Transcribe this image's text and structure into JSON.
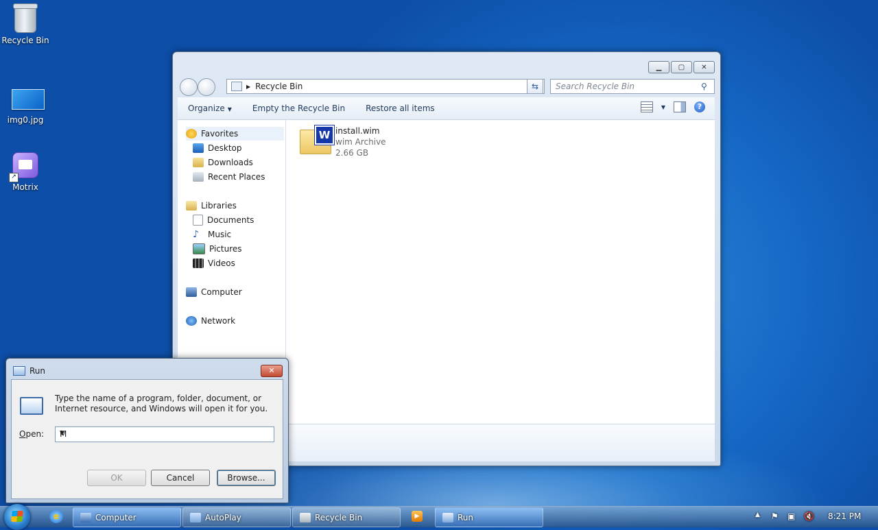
{
  "desktop": {
    "icons": [
      {
        "label": "Recycle Bin",
        "icon": "recycle-bin-icon"
      },
      {
        "label": "img0.jpg",
        "icon": "image-file-icon"
      },
      {
        "label": "Motrix",
        "icon": "motrix-app-icon"
      }
    ]
  },
  "explorer": {
    "address": "Recycle Bin",
    "search_placeholder": "Search Recycle Bin",
    "commands": {
      "organize": "Organize",
      "empty": "Empty the Recycle Bin",
      "restore": "Restore all items"
    },
    "nav": {
      "favorites": "Favorites",
      "desktop": "Desktop",
      "downloads": "Downloads",
      "recent": "Recent Places",
      "libraries": "Libraries",
      "documents": "Documents",
      "music": "Music",
      "pictures": "Pictures",
      "videos": "Videos",
      "computer": "Computer",
      "network": "Network"
    },
    "files": [
      {
        "name": "install.wim",
        "type": "wim Archive",
        "size": "2.66 GB"
      }
    ]
  },
  "run": {
    "title": "Run",
    "description": "Type the name of a program, folder, document, or Internet resource, and Windows will open it for you.",
    "open_label": "Open:",
    "open_value": "M",
    "ok": "OK",
    "cancel": "Cancel",
    "browse": "Browse..."
  },
  "taskbar": {
    "items": [
      {
        "label": "Computer",
        "active": true
      },
      {
        "label": "AutoPlay"
      },
      {
        "label": "Recycle Bin"
      },
      {
        "label": "Run",
        "active": true
      }
    ],
    "clock": "8:21 PM"
  },
  "colors": {
    "accent": "#1567c4",
    "taskbar": "#2b5a8e",
    "close": "#c34a32"
  }
}
